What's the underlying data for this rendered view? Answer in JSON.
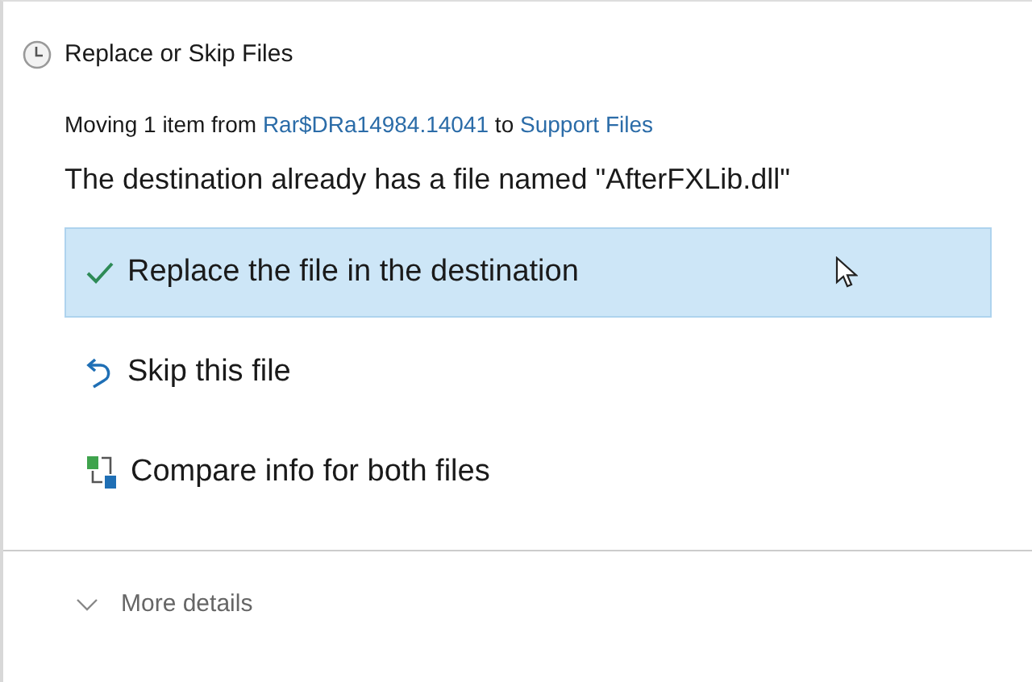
{
  "window": {
    "title": "Replace or Skip Files"
  },
  "moving": {
    "prefix": "Moving 1 item from",
    "source": "Rar$DRa14984.14041",
    "middle": "to",
    "destination": "Support Files"
  },
  "message": "The destination already has a file named \"AfterFXLib.dll\"",
  "options": [
    {
      "kind": "replace",
      "label": "Replace the file in the destination",
      "selected": true
    },
    {
      "kind": "skip",
      "label": "Skip this file",
      "selected": false
    },
    {
      "kind": "compare",
      "label": "Compare info for both files",
      "selected": false
    }
  ],
  "details": {
    "label": "More details",
    "expanded": false
  }
}
